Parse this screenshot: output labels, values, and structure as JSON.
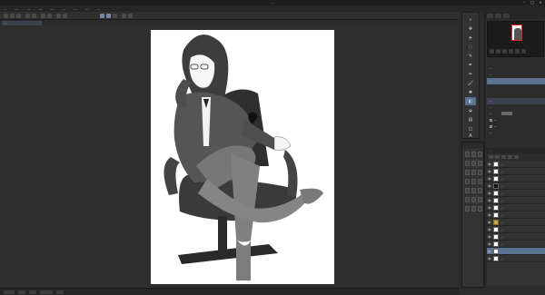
{
  "window": {
    "title": "...",
    "controls": [
      "–",
      "□",
      "×"
    ]
  },
  "menu": {
    "items": [
      "...",
      "...",
      "...",
      "...",
      "...",
      "...",
      "...",
      "...",
      "..."
    ]
  },
  "document": {
    "tab": "..."
  },
  "canvas": {
    "background": "#2e2e2e",
    "paper": "#ffffff"
  },
  "tools": {
    "items": [
      {
        "icon": "zoom-icon",
        "glyph": "⌕"
      },
      {
        "icon": "move-icon",
        "glyph": "✥"
      },
      {
        "icon": "operation-icon",
        "glyph": "➤"
      },
      {
        "icon": "lasso-icon",
        "glyph": "◌"
      },
      {
        "icon": "eyedropper-icon",
        "glyph": "✎"
      },
      {
        "icon": "pen-icon",
        "glyph": "✒"
      },
      {
        "icon": "pencil-icon",
        "glyph": "✏"
      },
      {
        "icon": "brush-icon",
        "glyph": "🖌"
      },
      {
        "icon": "airbrush-icon",
        "glyph": "✺"
      },
      {
        "icon": "eraser-icon",
        "glyph": "◧"
      },
      {
        "icon": "fill-icon",
        "glyph": "⬙"
      },
      {
        "icon": "gradient-icon",
        "glyph": "▤"
      },
      {
        "icon": "figure-icon",
        "glyph": "◻"
      },
      {
        "icon": "text-icon",
        "glyph": "A"
      }
    ]
  },
  "colors": {
    "main": "#ffffff",
    "sub": "#c62a2a",
    "accent": "#59708e"
  },
  "right": {
    "tool_property_rows": [
      "...",
      "...",
      "..."
    ],
    "sub_rows": [
      "...",
      "...",
      "...",
      "...",
      "...",
      "..."
    ],
    "layers": {
      "header": "...",
      "rows": [
        {
          "name": "...",
          "thumb": "white",
          "kind": "normal"
        },
        {
          "name": "...",
          "thumb": "white",
          "kind": "normal"
        },
        {
          "name": "...",
          "thumb": "white",
          "kind": "normal"
        },
        {
          "name": "...",
          "thumb": "black",
          "kind": "normal"
        },
        {
          "name": "...",
          "thumb": "white",
          "kind": "normal"
        },
        {
          "name": "...",
          "thumb": "white",
          "kind": "normal"
        },
        {
          "name": "...",
          "thumb": "white",
          "kind": "normal"
        },
        {
          "name": "...",
          "thumb": "white",
          "kind": "normal"
        },
        {
          "name": "...",
          "thumb": "white",
          "kind": "folder"
        },
        {
          "name": "...",
          "thumb": "white",
          "kind": "normal"
        },
        {
          "name": "...",
          "thumb": "white",
          "kind": "normal"
        },
        {
          "name": "...",
          "thumb": "white",
          "kind": "normal"
        },
        {
          "name": "...",
          "thumb": "white",
          "kind": "selected"
        },
        {
          "name": "...",
          "thumb": "white",
          "kind": "normal"
        }
      ]
    }
  }
}
